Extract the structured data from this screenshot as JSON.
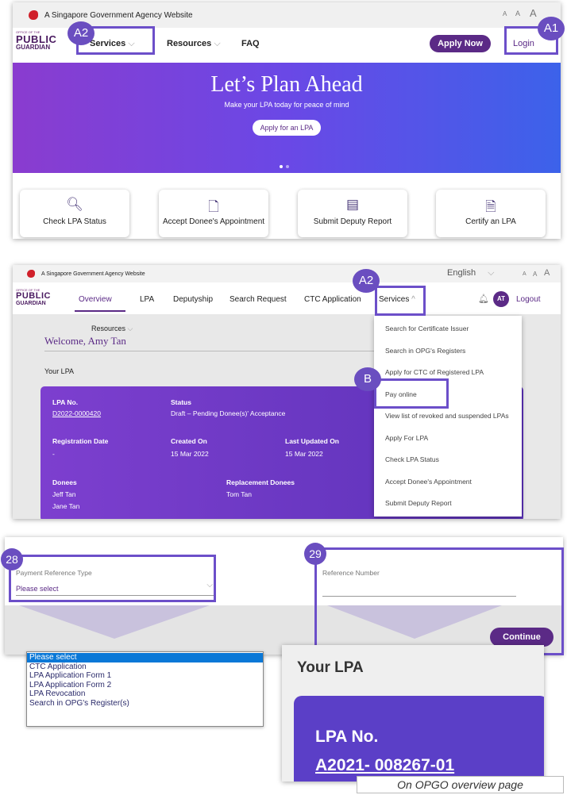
{
  "panel1": {
    "gov_text": "A Singapore Government Agency Website",
    "font_sizes": [
      "A",
      "A",
      "A"
    ],
    "logo": {
      "line1": "OFFICE OF THE",
      "line2": "PUBLIC",
      "line3": "GUARDIAN"
    },
    "nav": {
      "services": "Services",
      "resources": "Resources",
      "faq": "FAQ"
    },
    "apply_now": "Apply Now",
    "login": "Login",
    "hero": {
      "title": "Let’s Plan Ahead",
      "subtitle": "Make your LPA today for peace of mind",
      "button": "Apply for an LPA"
    },
    "cards": [
      {
        "label": "Check LPA Status",
        "icon": "search-icon"
      },
      {
        "label": "Accept Donee's Appointment",
        "icon": "document-icon"
      },
      {
        "label": "Submit Deputy Report",
        "icon": "report-icon"
      },
      {
        "label": "Certify an LPA",
        "icon": "certify-doc-icon"
      }
    ],
    "badge_a1": "A1",
    "badge_a2": "A2"
  },
  "panel2": {
    "gov_text": "A Singapore Government Agency Website",
    "language": "English",
    "font_sizes": [
      "A",
      "A",
      "A"
    ],
    "logo": {
      "line1": "OFFICE OF THE",
      "line2": "PUBLIC",
      "line3": "GUARDIAN"
    },
    "nav": {
      "overview": "Overview",
      "lpa": "LPA",
      "deputyship": "Deputyship",
      "search_request": "Search Request",
      "ctc": "CTC Application",
      "services": "Services"
    },
    "avatar": "AT",
    "logout": "Logout",
    "resources": "Resources",
    "welcome": "Welcome, Amy Tan",
    "your_lpa": "Your LPA",
    "badge_a2": "A2",
    "badge_b": "B",
    "menu": [
      "Search for Certificate Issuer",
      "Search in OPG's Registers",
      "Apply for CTC of Registered LPA",
      "Pay online",
      "View list of revoked and suspended LPAs",
      "Apply For LPA",
      "Check LPA Status",
      "Accept Donee's Appointment",
      "Submit Deputy Report"
    ],
    "lpa_card": {
      "lpa_no_label": "LPA No.",
      "lpa_no": "D2022-0000420",
      "status_label": "Status",
      "status": "Draft – Pending Donee(s)' Acceptance",
      "reg_label": "Registration Date",
      "reg": "-",
      "created_label": "Created On",
      "created": "15 Mar 2022",
      "updated_label": "Last Updated On",
      "updated": "15 Mar 2022",
      "donees_label": "Donees",
      "donee1": "Jeff Tan",
      "donee2": "Jane Tan",
      "replacement_label": "Replacement Donees",
      "replacement": "Tom Tan"
    }
  },
  "panel3": {
    "badge_28": "28",
    "badge_29": "29",
    "payment_ref_label": "Payment Reference Type",
    "payment_ref_value": "Please select",
    "ref_number_label": "Reference Number",
    "continue": "Continue",
    "dropdown_options": [
      "Please select",
      "CTC Application",
      "LPA Application Form 1",
      "LPA Application Form 2",
      "LPA Revocation",
      "Search in OPG's Register(s)"
    ],
    "zoom": {
      "title": "Your LPA",
      "lpa_label": "LPA No.",
      "lpa_no": "A2021- 008267-01"
    },
    "caption": "On OPGO overview page"
  },
  "colors": {
    "purple": "#6a4ec0",
    "dark_purple": "#5b2a86",
    "hero_start": "#7b3fd8",
    "hero_end": "#2f60e8"
  }
}
